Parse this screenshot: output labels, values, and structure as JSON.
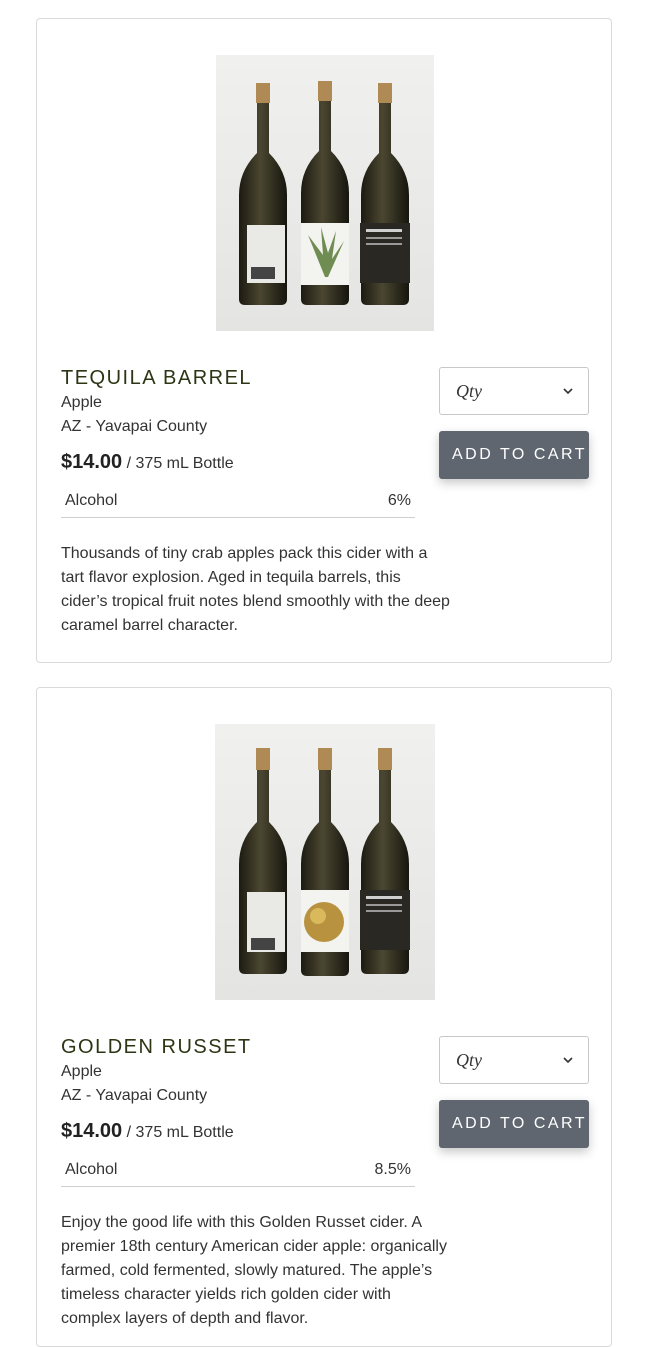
{
  "products": [
    {
      "name": "TEQUILA BARREL",
      "variety": "Apple",
      "region": "AZ - Yavapai County",
      "price": "$14.00",
      "unit": "/ 375 mL Bottle",
      "attribute_label": "Alcohol",
      "attribute_value": "6%",
      "description": "Thousands of tiny crab apples pack this cider with a tart flavor explosion. Aged in tequila barrels, this cider’s tropical fruit notes blend smoothly with the deep caramel barrel character.",
      "qty_label": "Qty",
      "add_to_cart": "ADD TO CART"
    },
    {
      "name": "GOLDEN RUSSET",
      "variety": "Apple",
      "region": "AZ - Yavapai County",
      "price": "$14.00",
      "unit": "/ 375 mL Bottle",
      "attribute_label": "Alcohol",
      "attribute_value": "8.5%",
      "description": "Enjoy the good life with this Golden Russet cider. A premier 18th century American cider apple: organically farmed, cold fermented, slowly matured. The apple’s timeless character yields rich golden cider with complex layers of depth and flavor.",
      "qty_label": "Qty",
      "add_to_cart": "ADD TO CART"
    }
  ],
  "colors": {
    "title_green": "#2d3614",
    "button_gray": "#5f6670",
    "card_border": "#d9d9d9"
  },
  "icons": {
    "qty_dropdown": "chevron-down-icon"
  }
}
